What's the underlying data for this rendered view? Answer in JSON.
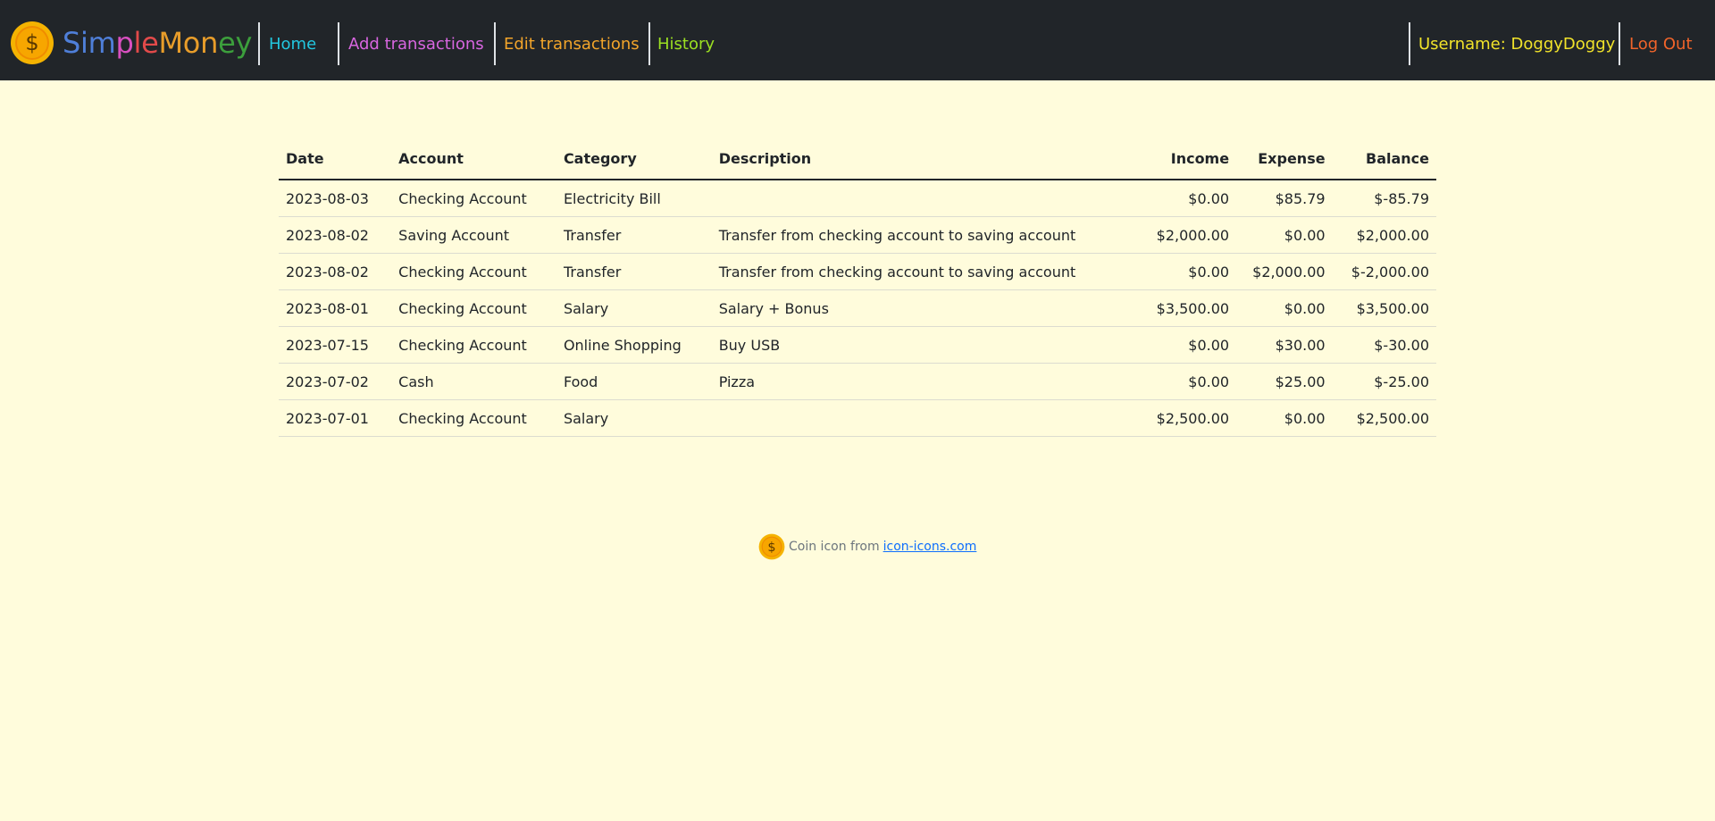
{
  "brand": {
    "name": "SimpleMoney",
    "letter_colors": [
      "#4f7fd9",
      "#4f7fd9",
      "#4f7fd9",
      "#d94fc0",
      "#e24a4a",
      "#e24a4a",
      "#e89d2a",
      "#e89d2a",
      "#e89d2a",
      "#3c9f3c",
      "#3c9f3c"
    ],
    "icon": "coin-icon"
  },
  "nav": {
    "home": {
      "label": "Home",
      "color": "#22c7e0"
    },
    "add": {
      "label": "Add transactions",
      "color": "#d866e0"
    },
    "edit": {
      "label": "Edit transactions",
      "color": "#f3a52a"
    },
    "history": {
      "label": "History",
      "color": "#9be022"
    },
    "username": {
      "label": "Username: DoggyDoggy",
      "color": "#f1e32a"
    },
    "logout": {
      "label": "Log Out",
      "color": "#f0642a"
    }
  },
  "table": {
    "headers": [
      "Date",
      "Account",
      "Category",
      "Description",
      "Income",
      "Expense",
      "Balance"
    ],
    "rows": [
      [
        "2023-08-03",
        "Checking Account",
        "Electricity Bill",
        "",
        "$0.00",
        "$85.79",
        "$-85.79"
      ],
      [
        "2023-08-02",
        "Saving Account",
        "Transfer",
        "Transfer from checking account to saving account",
        "$2,000.00",
        "$0.00",
        "$2,000.00"
      ],
      [
        "2023-08-02",
        "Checking Account",
        "Transfer",
        "Transfer from checking account to saving account",
        "$0.00",
        "$2,000.00",
        "$-2,000.00"
      ],
      [
        "2023-08-01",
        "Checking Account",
        "Salary",
        "Salary + Bonus",
        "$3,500.00",
        "$0.00",
        "$3,500.00"
      ],
      [
        "2023-07-15",
        "Checking Account",
        "Online Shopping",
        "Buy USB",
        "$0.00",
        "$30.00",
        "$-30.00"
      ],
      [
        "2023-07-02",
        "Cash",
        "Food",
        "Pizza",
        "$0.00",
        "$25.00",
        "$-25.00"
      ],
      [
        "2023-07-01",
        "Checking Account",
        "Salary",
        "",
        "$2,500.00",
        "$0.00",
        "$2,500.00"
      ]
    ]
  },
  "footer": {
    "text": "Coin icon from",
    "link_label": "icon-icons.com",
    "icon": "coin-icon"
  }
}
